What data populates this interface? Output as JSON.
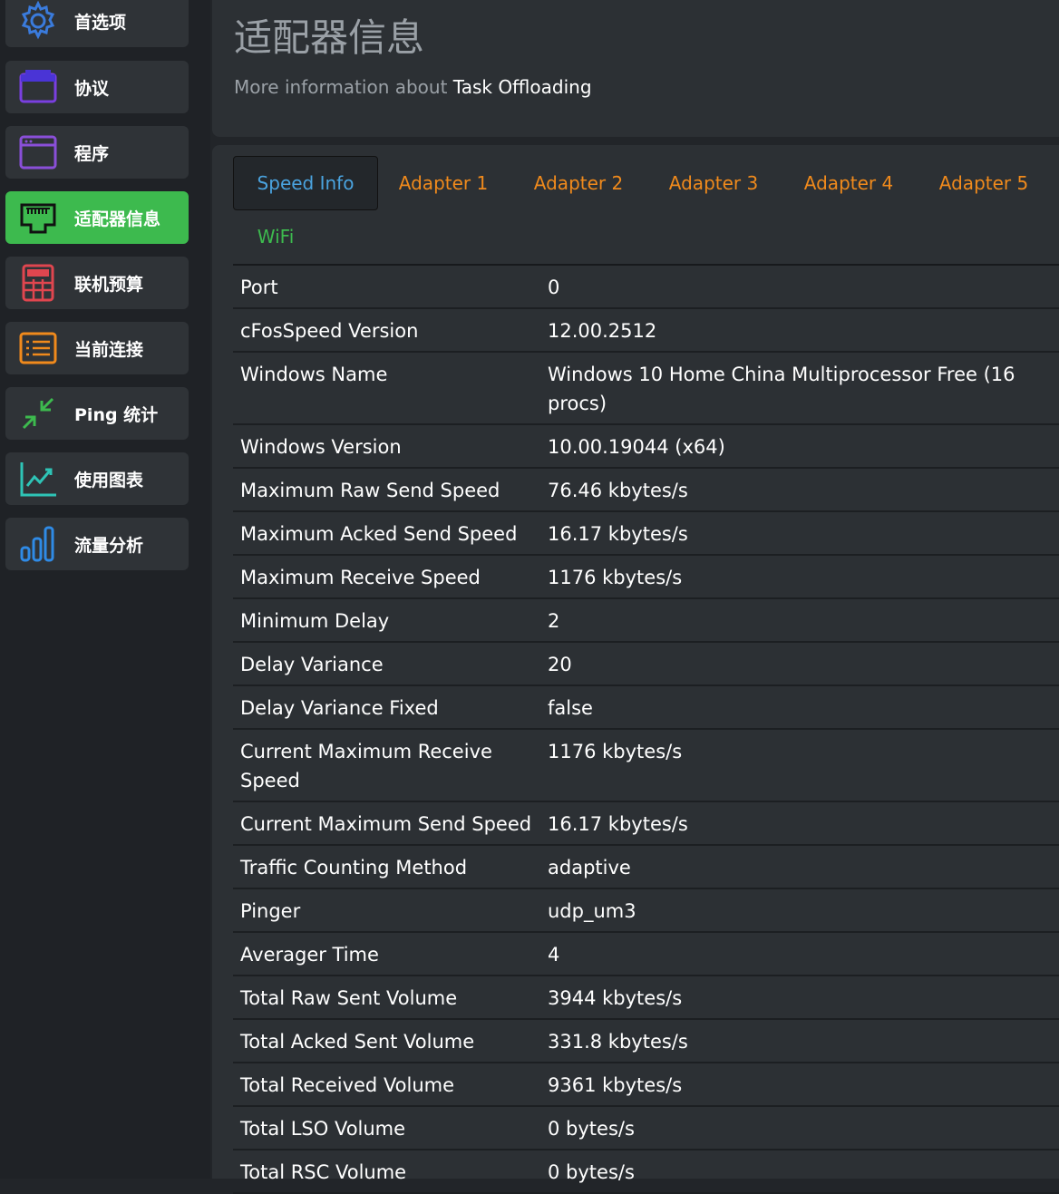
{
  "sidebar": {
    "items": [
      {
        "label": "首选项",
        "icon": "gear-icon"
      },
      {
        "label": "协议",
        "icon": "protocol-window-icon"
      },
      {
        "label": "程序",
        "icon": "program-window-icon"
      },
      {
        "label": "适配器信息",
        "icon": "network-adapter-icon",
        "active": true
      },
      {
        "label": "联机预算",
        "icon": "calculator-icon"
      },
      {
        "label": "当前连接",
        "icon": "list-icon"
      },
      {
        "label": "Ping 统计",
        "icon": "compress-arrows-icon"
      },
      {
        "label": "使用图表",
        "icon": "line-chart-icon"
      },
      {
        "label": "流量分析",
        "icon": "bar-chart-icon"
      }
    ]
  },
  "header": {
    "title": "适配器信息",
    "subtitle_prefix": "More information about",
    "subtitle_link": "Task Offloading"
  },
  "tabs": [
    {
      "label": "Speed Info",
      "active": true
    },
    {
      "label": "Adapter 1"
    },
    {
      "label": "Adapter 2"
    },
    {
      "label": "Adapter 3"
    },
    {
      "label": "Adapter 4"
    },
    {
      "label": "Adapter 5"
    },
    {
      "label": "WiFi"
    }
  ],
  "rows": [
    {
      "key": "Port",
      "value": "0"
    },
    {
      "key": "cFosSpeed Version",
      "value": "12.00.2512"
    },
    {
      "key": "Windows Name",
      "value": "Windows 10 Home China Multiprocessor Free (16 procs)"
    },
    {
      "key": "Windows Version",
      "value": "10.00.19044 (x64)"
    },
    {
      "key": "Maximum Raw Send Speed",
      "value": "76.46 kbytes/s"
    },
    {
      "key": "Maximum Acked Send Speed",
      "value": "16.17 kbytes/s"
    },
    {
      "key": "Maximum Receive Speed",
      "value": "1176 kbytes/s"
    },
    {
      "key": "Minimum Delay",
      "value": "2"
    },
    {
      "key": "Delay Variance",
      "value": "20"
    },
    {
      "key": "Delay Variance Fixed",
      "value": "false"
    },
    {
      "key": "Current Maximum Receive Speed",
      "value": "1176 kbytes/s"
    },
    {
      "key": "Current Maximum Send Speed",
      "value": "16.17 kbytes/s"
    },
    {
      "key": "Traffic Counting Method",
      "value": "adaptive"
    },
    {
      "key": "Pinger",
      "value": "udp_um3"
    },
    {
      "key": "Averager Time",
      "value": "4"
    },
    {
      "key": "Total Raw Sent Volume",
      "value": "3944 kbytes/s"
    },
    {
      "key": "Total Acked Sent Volume",
      "value": "331.8 kbytes/s"
    },
    {
      "key": "Total Received Volume",
      "value": "9361 kbytes/s"
    },
    {
      "key": "Total LSO Volume",
      "value": "0 bytes/s"
    },
    {
      "key": "Total RSC Volume",
      "value": "0 bytes/s"
    }
  ],
  "colors": {
    "accent_active": "#3dba4e",
    "tab_inactive": "#f08a1c",
    "tab_active": "#4aa3df"
  }
}
